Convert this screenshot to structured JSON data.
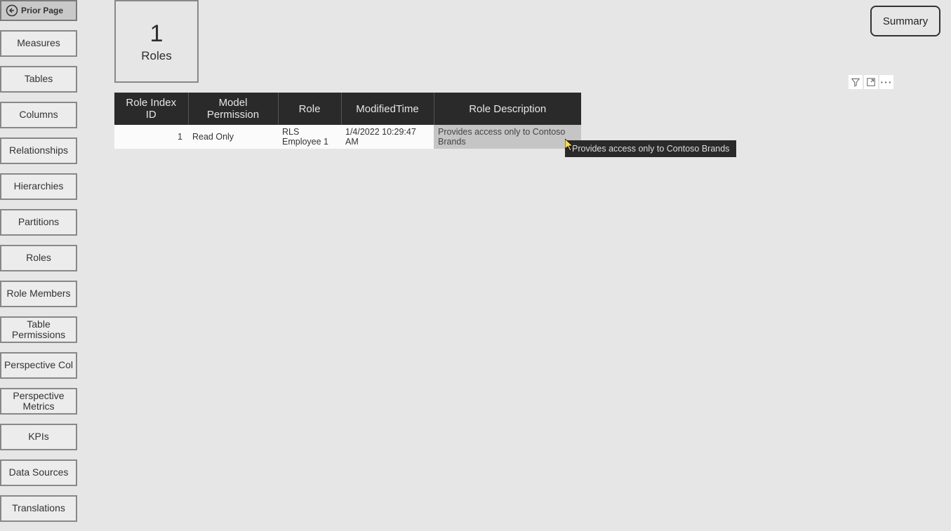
{
  "priorPage": {
    "label": "Prior Page"
  },
  "nav": [
    "Measures",
    "Tables",
    "Columns",
    "Relationships",
    "Hierarchies",
    "Partitions",
    "Roles",
    "Role Members",
    "Table Permissions",
    "Perspective Col",
    "Perspective Metrics",
    "KPIs",
    "Data Sources",
    "Translations"
  ],
  "card": {
    "value": "1",
    "label": "Roles"
  },
  "summary": {
    "label": "Summary"
  },
  "table": {
    "headers": {
      "roleIndex": "Role Index ID",
      "modelPerm": "Model Permission",
      "role": "Role",
      "modTime": "ModifiedTime",
      "desc": "Role Description"
    },
    "rows": [
      {
        "roleIndex": "1",
        "modelPerm": "Read Only",
        "role": "RLS Employee 1",
        "modTime": "1/4/2022 10:29:47 AM",
        "desc": "Provides access only to Contoso Brands"
      }
    ]
  },
  "tooltip": "Provides access only to Contoso Brands"
}
